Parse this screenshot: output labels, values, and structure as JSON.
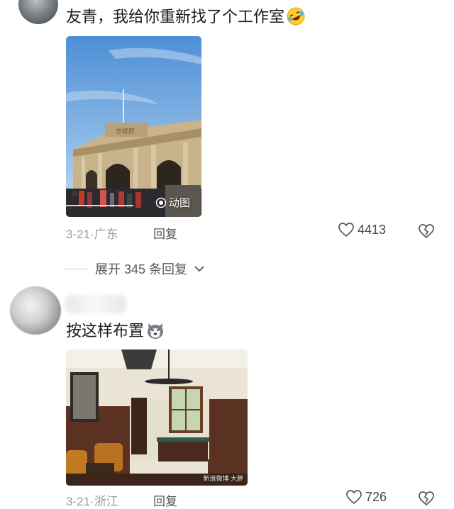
{
  "comments": [
    {
      "text": "友青，我给你重新找了个工作室",
      "emoji_icon": "rolling-laughing-emoji-icon",
      "image": {
        "badge_label": "动图",
        "subject": "building"
      },
      "date": "3-21",
      "separator": "·",
      "location": "广东",
      "reply_label": "回复",
      "like_count": "4413"
    },
    {
      "text": "按这样布置",
      "emoji_icon": "husky-face-emoji-icon",
      "image": {
        "watermark": "新浪微博 大胖",
        "subject": "office"
      },
      "date": "3-21",
      "separator": "·",
      "location": "浙江",
      "reply_label": "回复",
      "like_count": "726"
    }
  ],
  "expand_replies": {
    "label": "展开 345 条回复"
  },
  "colors": {
    "meta_gray": "#9c9c9c",
    "text_dark": "#1c1c1c"
  }
}
